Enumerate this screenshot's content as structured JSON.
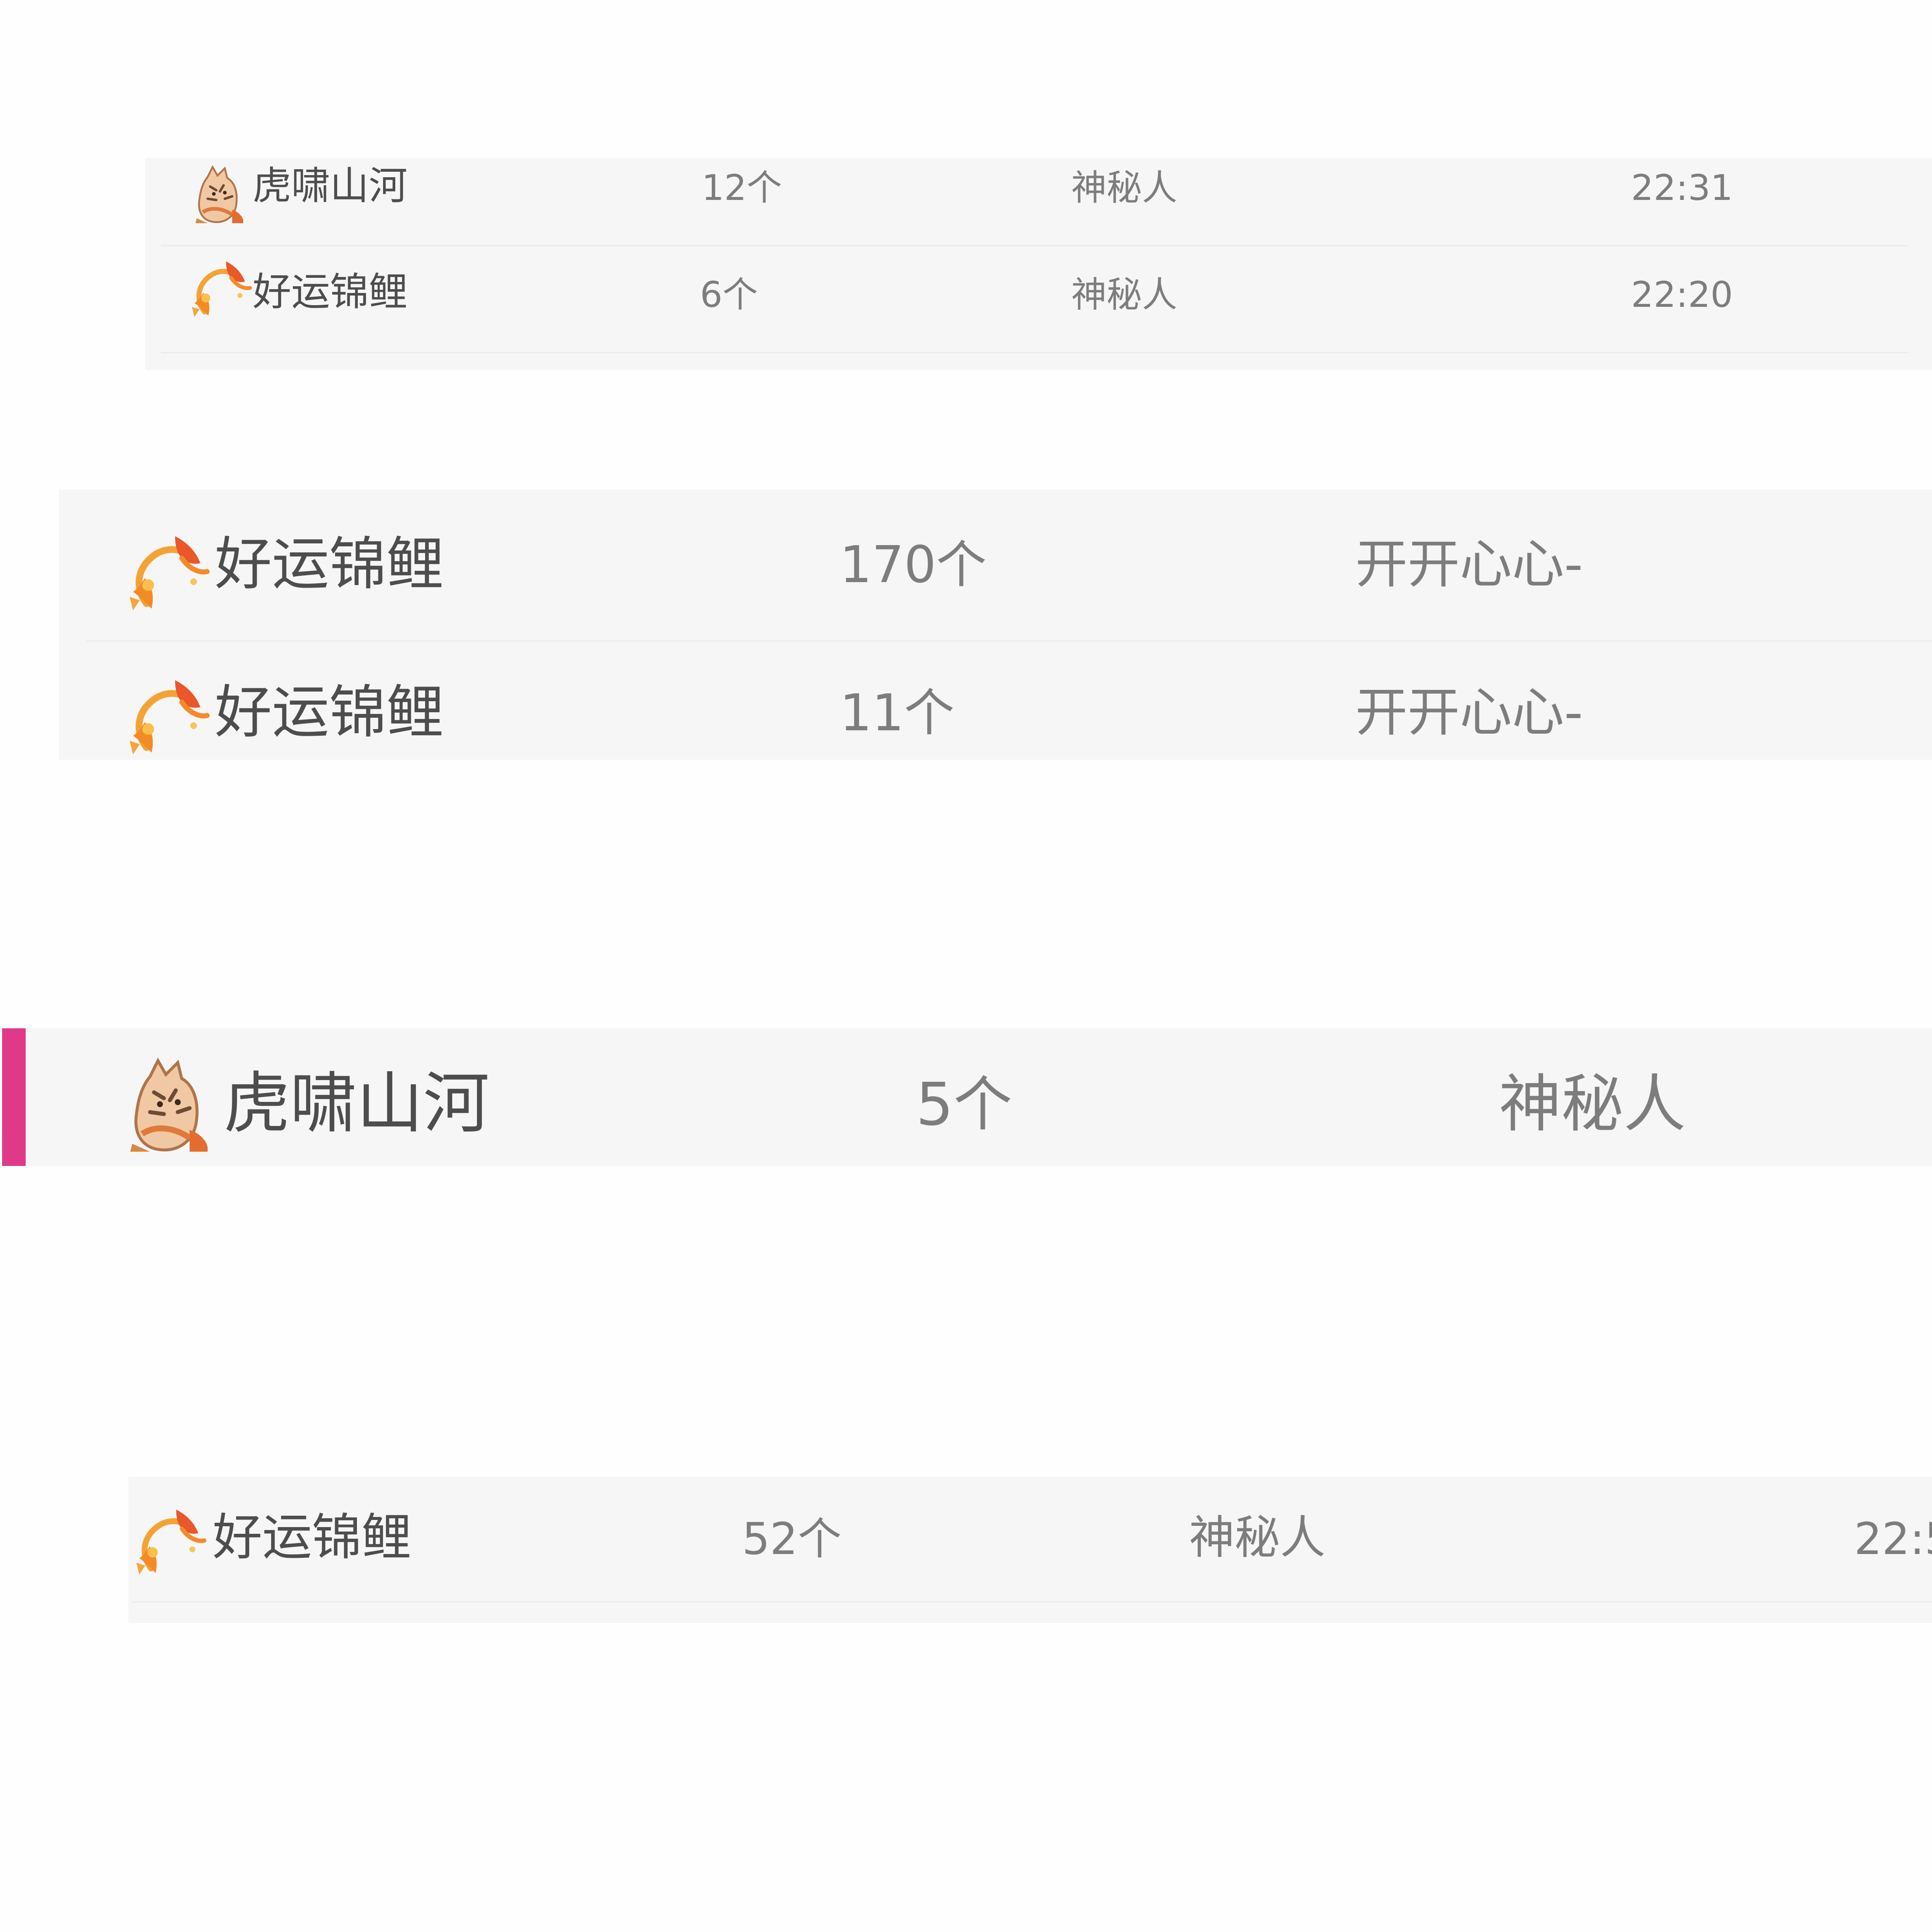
{
  "colors": {
    "panel_background": "#f6f6f6",
    "page_background": "#fefefe",
    "divider": "#ececec",
    "text": "#7d7d7d",
    "name_text": "#4d4d4d",
    "accent": "#e0398a"
  },
  "clip1": {
    "rows": [
      {
        "icon": "tiger-gift-icon",
        "gift": "虎啸山河",
        "count": "12个",
        "sender": "神秘人",
        "time": "22:31"
      },
      {
        "icon": "koi-gift-icon",
        "gift": "好运锦鲤",
        "count": "6个",
        "sender": "神秘人",
        "time": "22:20"
      }
    ]
  },
  "clip2": {
    "rows": [
      {
        "icon": "koi-gift-icon",
        "gift": "好运锦鲤",
        "count": "170个",
        "sender": "开开心心-"
      },
      {
        "icon": "koi-gift-icon",
        "gift": "好运锦鲤",
        "count": "11个",
        "sender": "开开心心-"
      }
    ]
  },
  "clip3": {
    "rows": [
      {
        "icon": "tiger-gift-icon",
        "gift": "虎啸山河",
        "count": "5个",
        "sender": "神秘人"
      }
    ]
  },
  "clip4": {
    "rows": [
      {
        "icon": "koi-gift-icon",
        "gift": "好运锦鲤",
        "count": "52个",
        "sender": "神秘人",
        "time": "22:5"
      }
    ]
  }
}
